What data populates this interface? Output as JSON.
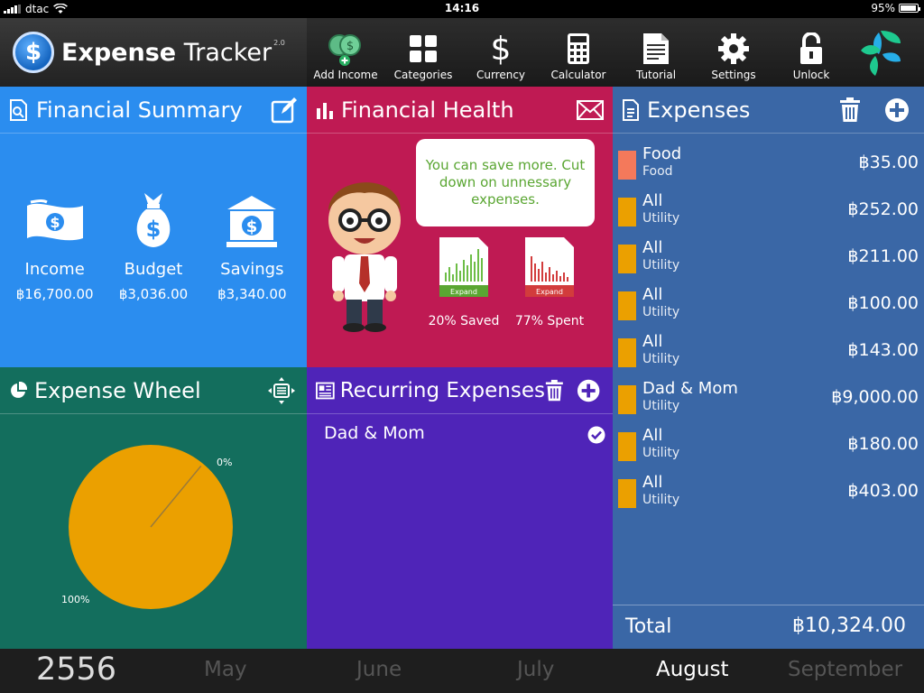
{
  "status": {
    "carrier": "dtac",
    "time": "14:16",
    "battery": "95%",
    "battery_level": 0.95
  },
  "app": {
    "title_bold": "Expense",
    "title_light": "Tracker",
    "version": "2.0"
  },
  "toolbar": [
    {
      "label": "Add Income",
      "icon": "add-income-icon"
    },
    {
      "label": "Categories",
      "icon": "categories-icon"
    },
    {
      "label": "Currency",
      "icon": "currency-icon"
    },
    {
      "label": "Calculator",
      "icon": "calculator-icon"
    },
    {
      "label": "Tutorial",
      "icon": "tutorial-icon"
    },
    {
      "label": "Settings",
      "icon": "settings-icon"
    },
    {
      "label": "Unlock",
      "icon": "unlock-icon"
    }
  ],
  "summary": {
    "title": "Financial Summary",
    "items": [
      {
        "name": "Income",
        "value": "฿16,700.00"
      },
      {
        "name": "Budget",
        "value": "฿3,036.00"
      },
      {
        "name": "Savings",
        "value": "฿3,340.00"
      }
    ]
  },
  "health": {
    "title": "Financial Health",
    "message": "You can save more. Cut down on unnessary expenses.",
    "saved_label": "20% Saved",
    "spent_label": "77% Spent",
    "expand_label": "Expand"
  },
  "expenses": {
    "title": "Expenses",
    "items": [
      {
        "name": "Food",
        "category": "Food",
        "amount": "฿35.00",
        "color": "#f4795b"
      },
      {
        "name": "All",
        "category": "Utility",
        "amount": "฿252.00",
        "color": "#eba000"
      },
      {
        "name": "All",
        "category": "Utility",
        "amount": "฿211.00",
        "color": "#eba000"
      },
      {
        "name": "All",
        "category": "Utility",
        "amount": "฿100.00",
        "color": "#eba000"
      },
      {
        "name": "All",
        "category": "Utility",
        "amount": "฿143.00",
        "color": "#eba000"
      },
      {
        "name": "Dad & Mom",
        "category": "Utility",
        "amount": "฿9,000.00",
        "color": "#eba000"
      },
      {
        "name": "All",
        "category": "Utility",
        "amount": "฿180.00",
        "color": "#eba000"
      },
      {
        "name": "All",
        "category": "Utility",
        "amount": "฿403.00",
        "color": "#eba000"
      }
    ],
    "total_label": "Total",
    "total_value": "฿10,324.00"
  },
  "wheel": {
    "title": "Expense Wheel",
    "pie_color": "#eba000",
    "slices": [
      {
        "label": "100%",
        "value": 100
      },
      {
        "label": "0%",
        "value": 0
      }
    ]
  },
  "recurring": {
    "title": "Recurring Expenses",
    "items": [
      {
        "name": "Dad & Mom"
      }
    ]
  },
  "timeline": {
    "year": "2556",
    "months": [
      "May",
      "June",
      "July",
      "August",
      "September"
    ],
    "active_month": "August"
  },
  "colors": {
    "summary": "#2b8def",
    "health": "#bf1a53",
    "expenses": "#3a67a6",
    "wheel": "#136e5d",
    "recurring": "#4f24b8"
  }
}
